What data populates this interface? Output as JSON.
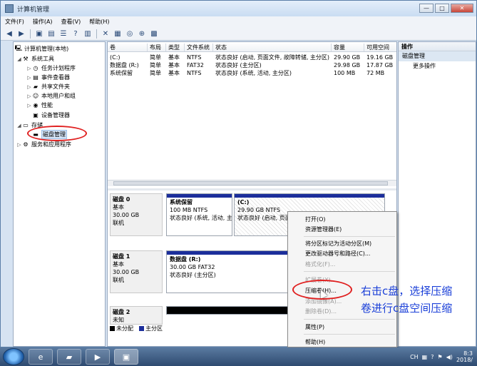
{
  "window": {
    "title": "计算机管理",
    "min_label": "—",
    "max_label": "□",
    "close_label": "✕"
  },
  "menu": [
    "文件(F)",
    "操作(A)",
    "查看(V)",
    "帮助(H)"
  ],
  "toolbar_icons": [
    "back-arrow-icon",
    "forward-arrow-icon",
    "up-folder-icon",
    "show-hide-tree-icon",
    "properties-icon",
    "help-icon",
    "console-icon",
    "delete-icon",
    "open-icon",
    "search-icon",
    "zoom-icon",
    "grid-icon"
  ],
  "tree": {
    "root": "计算机管理(本地)",
    "system_tools": "系统工具",
    "task_scheduler": "任务计划程序",
    "event_viewer": "事件查看器",
    "shared_folders": "共享文件夹",
    "local_users": "本地用户和组",
    "performance": "性能",
    "device_manager": "设备管理器",
    "storage": "存储",
    "disk_management": "磁盘管理",
    "services": "服务和应用程序"
  },
  "volume_table": {
    "headers": [
      "卷",
      "布局",
      "类型",
      "文件系统",
      "状态",
      "容量",
      "可用空间"
    ],
    "rows": [
      [
        "(C:)",
        "简单",
        "基本",
        "NTFS",
        "状态良好 (启动, 页面文件, 故障转储, 主分区)",
        "29.90 GB",
        "19.16 GB"
      ],
      [
        "数据盘 (R:)",
        "简单",
        "基本",
        "FAT32",
        "状态良好 (主分区)",
        "29.98 GB",
        "17.87 GB"
      ],
      [
        "系统保留",
        "简单",
        "基本",
        "NTFS",
        "状态良好 (系统, 活动, 主分区)",
        "100 MB",
        "72 MB"
      ]
    ]
  },
  "disks": [
    {
      "name": "磁盘 0",
      "type": "基本",
      "size": "30.00 GB",
      "state": "联机"
    },
    {
      "name": "磁盘 1",
      "type": "基本",
      "size": "30.00 GB",
      "state": "联机"
    },
    {
      "name": "磁盘 2",
      "type": "",
      "size": "",
      "state": "未知"
    }
  ],
  "partitions": {
    "sys_reserved": {
      "name": "系统保留",
      "size": "100 MB NTFS",
      "status": "状态良好 (系统, 活动, 主"
    },
    "c_drive": {
      "name": "(C:)",
      "size": "29.90 GB NTFS",
      "status": "状态良好 (启动, 页面"
    },
    "r_drive": {
      "name": "数据盘 (R:)",
      "size": "30.00 GB FAT32",
      "status": "状态良好 (主分区)"
    }
  },
  "legend": {
    "unallocated": "未分配",
    "primary": "主分区"
  },
  "actions": {
    "header": "操作",
    "section": "磁盘管理",
    "more": "更多操作"
  },
  "context_menu": {
    "open": "打开(O)",
    "explore": "资源管理器(E)",
    "mark_active": "将分区标记为活动分区(M)",
    "change_letter": "更改驱动器号和路径(C)...",
    "format": "格式化(F)...",
    "extend": "扩展卷(X)...",
    "shrink": "压缩卷(H)...",
    "add_mirror": "添加镜像(A)...",
    "delete": "删除卷(D)...",
    "properties": "属性(P)",
    "help": "帮助(H)"
  },
  "annotation": {
    "line1": "右击c盘，选择压缩",
    "line2": "卷进行c盘空间压缩"
  },
  "taskbar": {
    "lang": "CH",
    "time": "8:3",
    "date": "2018/"
  },
  "colors": {
    "primary_partition": "#1c2e9b",
    "unallocated": "#000000",
    "annotation_circle": "#e02020",
    "annotation_text": "#1a3fd8"
  }
}
